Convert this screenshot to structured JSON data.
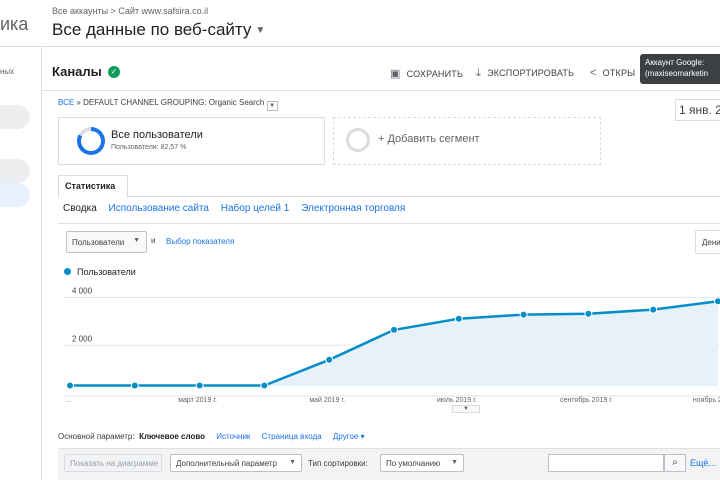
{
  "header": {
    "brand_fragment": "ика",
    "breadcrumb": "Все аккаунты > Сайт www.safsira.co.il",
    "view_title": "Все данные по веб-сайту"
  },
  "leftnav": {
    "label_fragment": "ных"
  },
  "report": {
    "title": "Каналы",
    "actions": {
      "save": "СОХРАНИТЬ",
      "export": "ЭКСПОРТИРОВАТЬ",
      "share": "ОТКРЫ"
    },
    "tooltip": [
      "Аккаунт Google:",
      "(maxiseomarketin"
    ],
    "crumb_all": "ВСЕ",
    "crumb_sep": "»",
    "crumb_rest": "DEFAULT CHANNEL GROUPING: Organic Search",
    "date_range": "1 янв. 2"
  },
  "segments": {
    "all_users": "Все пользователи",
    "all_users_sub": "Пользователи: 82,57 %",
    "all_users_share": 0.8257,
    "add_segment": "+ Добавить сегмент"
  },
  "tabs": {
    "active": "Статистика",
    "subtabs": [
      "Сводка",
      "Использование сайта",
      "Набор целей 1",
      "Электронная торговля"
    ]
  },
  "controls": {
    "metric": "Пользователи",
    "and": "и",
    "pick_metric": "Выбор показателя",
    "period_button": "Дени"
  },
  "chart_data": {
    "type": "line",
    "series": [
      {
        "name": "Пользователи",
        "color": "#058dc7",
        "values": [
          20,
          20,
          20,
          20,
          1100,
          2350,
          2820,
          2990,
          3030,
          3200,
          3550
        ]
      }
    ],
    "x": [
      "2019-01-01",
      "2019-02-01",
      "2019-03-01",
      "2019-04-01",
      "2019-05-01",
      "2019-06-01",
      "2019-07-01",
      "2019-08-01",
      "2019-09-01",
      "2019-10-01",
      "2019-11-01"
    ],
    "x_tick_labels": [
      "...",
      "март 2019 г.",
      "май 2019 г.",
      "июль 2019 г.",
      "сентябрь 2019 г.",
      "ноябрь 2019 г."
    ],
    "y_tick_labels": [
      "4 000",
      "2 000"
    ],
    "ylim": [
      0,
      4400
    ],
    "grid": true,
    "legend": "top-left"
  },
  "primary_dimension": {
    "label": "Основной параметр:",
    "current": "Ключевое слово",
    "links": [
      "Источник",
      "Страница входа"
    ],
    "more": "Другое ▾"
  },
  "table_controls": {
    "show_on_chart": "Показать на диаграмме",
    "secondary_dim": "Дополнительный параметр",
    "sort_label": "Тип сортировки:",
    "sort_value": "По умолчанию",
    "more": "Ещё..."
  }
}
